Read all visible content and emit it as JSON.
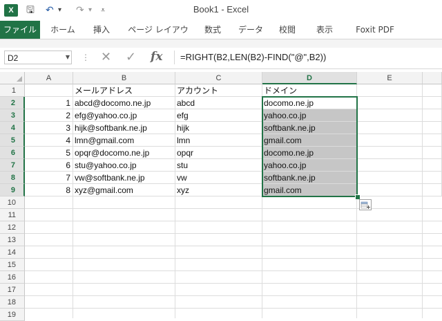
{
  "window": {
    "title": "Book1 - Excel",
    "app_icon_label": "X",
    "qat": {
      "save": "🖫",
      "undo": "↶",
      "undo_drop": "▾",
      "redo": "↷",
      "redo_drop": "▾",
      "customize": "⩡"
    }
  },
  "ribbon": {
    "tabs": [
      {
        "label": "ファイル"
      },
      {
        "label": "ホーム"
      },
      {
        "label": "挿入"
      },
      {
        "label": "ページ レイアウト"
      },
      {
        "label": "数式"
      },
      {
        "label": "データ"
      },
      {
        "label": "校閲"
      },
      {
        "label": "表示"
      },
      {
        "label": "Foxit PDF"
      }
    ]
  },
  "formula_bar": {
    "name_box": "D2",
    "dots": "⋮",
    "cancel": "✕",
    "enter": "✓",
    "fx": "fx",
    "formula": "=RIGHT(B2,LEN(B2)-FIND(\"@\",B2))"
  },
  "grid": {
    "columns": [
      "A",
      "B",
      "C",
      "D",
      "E"
    ],
    "selected_column": "D",
    "row_numbers": [
      "1",
      "2",
      "3",
      "4",
      "5",
      "6",
      "7",
      "8",
      "9",
      "10",
      "11",
      "12",
      "13",
      "14",
      "15",
      "16",
      "17",
      "18",
      "19"
    ],
    "header_row": {
      "B": "メールアドレス",
      "C": "アカウント",
      "D": "ドメイン"
    },
    "rows": [
      {
        "A": "1",
        "B": "abcd@docomo.ne.jp",
        "C": "abcd",
        "D": "docomo.ne.jp"
      },
      {
        "A": "2",
        "B": "efg@yahoo.co.jp",
        "C": "efg",
        "D": "yahoo.co.jp"
      },
      {
        "A": "3",
        "B": "hijk@softbank.ne.jp",
        "C": "hijk",
        "D": "softbank.ne.jp"
      },
      {
        "A": "4",
        "B": "lmn@gmail.com",
        "C": "lmn",
        "D": "gmail.com"
      },
      {
        "A": "5",
        "B": "opqr@docomo.ne.jp",
        "C": "opqr",
        "D": "docomo.ne.jp"
      },
      {
        "A": "6",
        "B": "stu@yahoo.co.jp",
        "C": "stu",
        "D": "yahoo.co.jp"
      },
      {
        "A": "7",
        "B": "vw@softbank.ne.jp",
        "C": "vw",
        "D": "softbank.ne.jp"
      },
      {
        "A": "8",
        "B": "xyz@gmail.com",
        "C": "xyz",
        "D": "gmail.com"
      }
    ],
    "selection": "D2:D9",
    "colors": {
      "accent": "#217346",
      "selection_fill": "#c6c6c6"
    }
  }
}
